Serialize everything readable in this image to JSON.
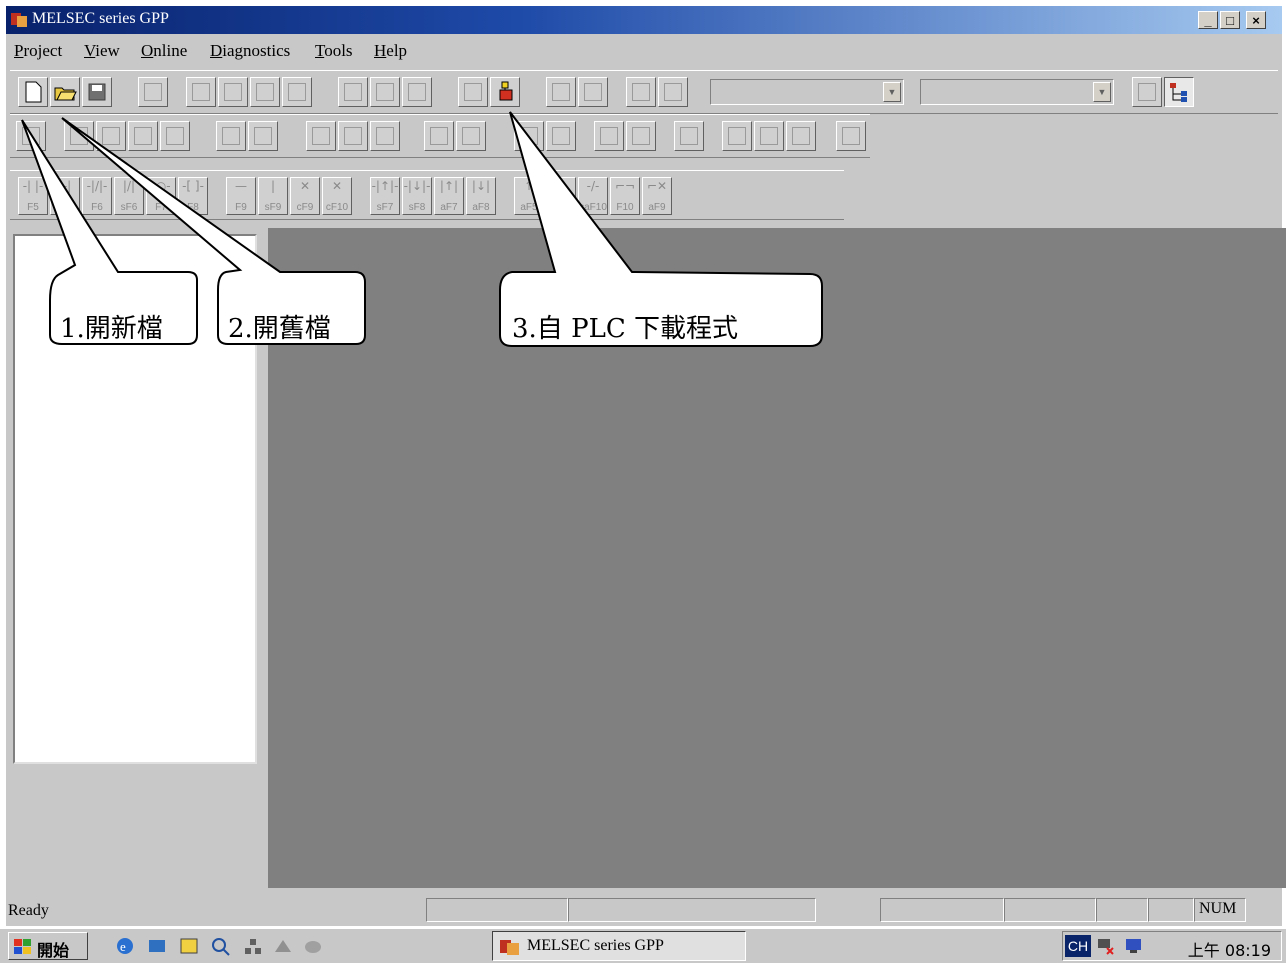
{
  "window": {
    "title": "MELSEC series GPP",
    "controls": [
      "_",
      "□",
      "×"
    ]
  },
  "menu": {
    "items": [
      {
        "label": "Project",
        "mnemonic": "P"
      },
      {
        "label": "View",
        "mnemonic": "V"
      },
      {
        "label": "Online",
        "mnemonic": "O"
      },
      {
        "label": "Diagnostics",
        "mnemonic": "D"
      },
      {
        "label": "Tools",
        "mnemonic": "T"
      },
      {
        "label": "Help",
        "mnemonic": "H"
      }
    ]
  },
  "toolbar3": {
    "keys": [
      "F5",
      "sF5",
      "F6",
      "sF6",
      "F7",
      "F8",
      "F9",
      "sF9",
      "cF9",
      "cF10",
      "sF7",
      "sF8",
      "aF7",
      "aF8",
      "aF5",
      "caF5",
      "caF10",
      "F10",
      "aF9"
    ]
  },
  "callouts": {
    "new_file": "1.開新檔",
    "open_file": "2.開舊檔",
    "read_plc": "3.自 PLC  下載程式"
  },
  "status": {
    "text": "Ready",
    "num": "NUM"
  },
  "taskbar": {
    "start": "開始",
    "task": "MELSEC series GPP",
    "ime": "CH",
    "clock": "上午 08:19"
  },
  "colors": {
    "titlebar_start": "#08216b",
    "mdi_background": "#808080",
    "face": "#c8c8c8"
  }
}
